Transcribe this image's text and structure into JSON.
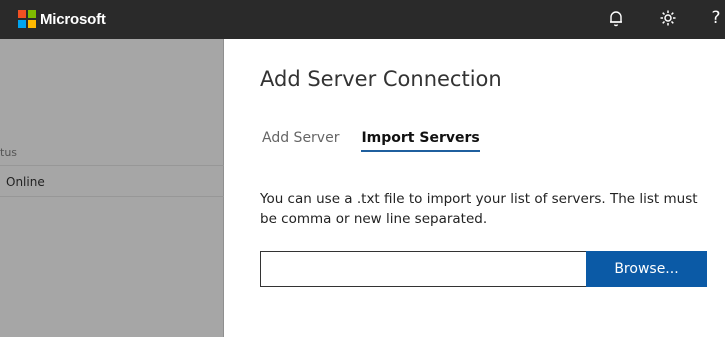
{
  "header": {
    "brand": "Microsoft",
    "logo_colors": [
      "#f25022",
      "#7fba00",
      "#00a4ef",
      "#ffb900"
    ],
    "icons": [
      "bell-icon",
      "gear-icon",
      "help-icon"
    ],
    "help_glyph": "?"
  },
  "background_list": {
    "column_header": "tus",
    "rows": [
      {
        "status": "Online"
      }
    ]
  },
  "dialog": {
    "title": "Add Server Connection",
    "tabs": [
      {
        "label": "Add Server",
        "active": false
      },
      {
        "label": "Import Servers",
        "active": true
      }
    ],
    "description": "You can use a .txt file to import your list of servers. The list must be comma or new line separated.",
    "file_input": {
      "value": "",
      "placeholder": ""
    },
    "browse_label": "Browse...",
    "accent_color": "#0b5aa6"
  }
}
